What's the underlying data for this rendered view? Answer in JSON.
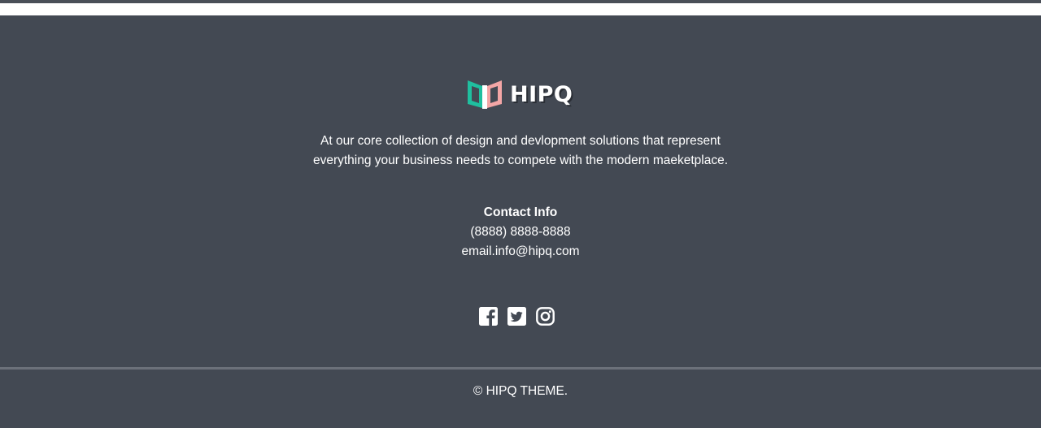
{
  "brand": {
    "name": "HIPQ",
    "logo_colors": {
      "left": "#1fbf9f",
      "right": "#f4a6a6"
    }
  },
  "about": {
    "text": "At our core collection of design and devlopment solutions that represent everything your business needs to compete with the modern maeketplace."
  },
  "contact": {
    "heading": "Contact Info",
    "phone": "(8888) 8888-8888",
    "email": "email.info@hipq.com"
  },
  "social": [
    {
      "name": "facebook",
      "icon": "facebook-icon"
    },
    {
      "name": "twitter",
      "icon": "twitter-icon"
    },
    {
      "name": "instagram",
      "icon": "instagram-icon"
    }
  ],
  "copyright": "© HIPQ THEME.",
  "colors": {
    "footer_bg": "#434953",
    "divider": "#6c717a",
    "text": "#ffffff"
  }
}
